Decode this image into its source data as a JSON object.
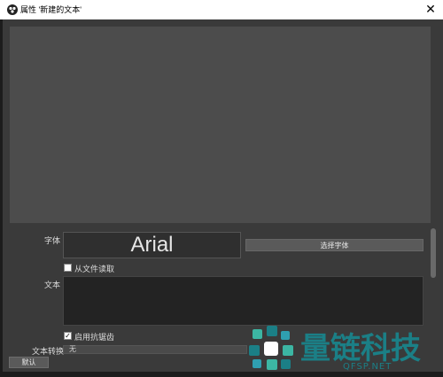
{
  "window": {
    "title": "属性 '新建的文本'",
    "close_glyph": "✕"
  },
  "form": {
    "font_label": "字体",
    "font_preview": "Arial",
    "select_font_button": "选择字体",
    "read_from_file_label": "从文件读取",
    "read_from_file_checked": false,
    "text_label": "文本",
    "text_value": "",
    "antialias_label": "启用抗锯齿",
    "antialias_checked": true,
    "text_transform_label": "文本转换",
    "text_transform_value": "无"
  },
  "footer": {
    "default_button": "默认"
  },
  "watermark": {
    "brand": "量链科技",
    "domain": "QFSP.NET",
    "color": "#1b7f86"
  },
  "colors": {
    "preview_bg": "#4c4c4c",
    "window_bg": "#3a3a3a"
  }
}
